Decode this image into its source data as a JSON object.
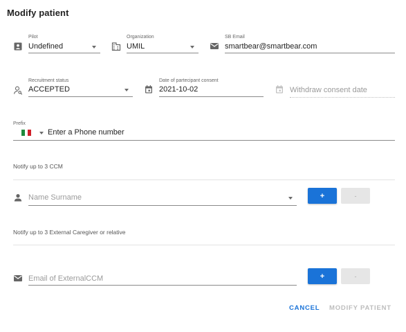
{
  "dialog": {
    "title": "Modify patient"
  },
  "row1": {
    "pilot": {
      "label": "Pilot",
      "value": "Undefined"
    },
    "organization": {
      "label": "Organization",
      "value": "UMIL"
    },
    "sb_email": {
      "label": "SB Email",
      "value": "smartbear@smartbear.com"
    }
  },
  "row2": {
    "recruitment": {
      "label": "Recruitment status",
      "value": "ACCEPTED"
    },
    "consent": {
      "label": "Date of partecipant consent",
      "value": "2021-10-02"
    },
    "withdraw": {
      "placeholder": "Withdraw consent date"
    }
  },
  "phone": {
    "prefix_label": "Prefix",
    "placeholder": "Enter a Phone number",
    "flag_colors": [
      "#1e8a3c",
      "#ffffff",
      "#d0202a"
    ]
  },
  "ccm": {
    "section_title": "Notify up to 3 CCM",
    "placeholder": "Name Surname",
    "add_label": "+",
    "remove_label": "-"
  },
  "caregiver": {
    "section_title": "Notify up to 3 External Caregiver or relative",
    "placeholder": "Email of ExternalCCM",
    "add_label": "+",
    "remove_label": "-"
  },
  "actions": {
    "cancel": "CANCEL",
    "modify": "MODIFY PATIENT"
  },
  "colors": {
    "accent": "#1a73d8",
    "disabled": "#bdbdbd"
  }
}
